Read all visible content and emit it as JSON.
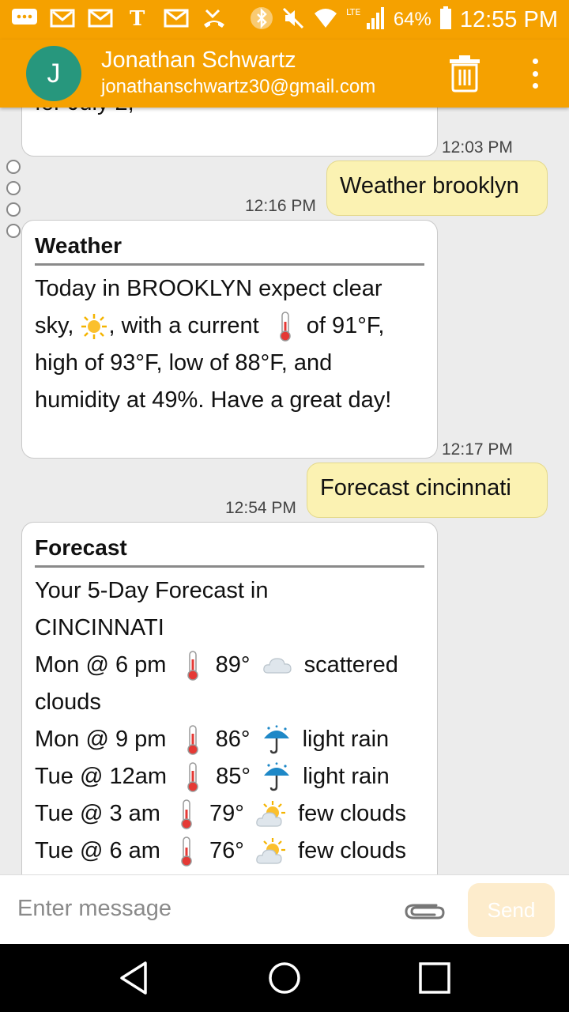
{
  "status_bar": {
    "battery_percent": "64%",
    "time": "12:55 PM",
    "network_label": "LTE"
  },
  "contact": {
    "initial": "J",
    "name": "Jonathan Schwartz",
    "email": "jonathanschwartz30@gmail.com"
  },
  "messages": [
    {
      "time": "12:03 PM",
      "partial_text": "for July 2,"
    },
    {
      "text": "Weather brooklyn",
      "time": "12:16 PM"
    },
    {
      "title": "Weather",
      "time": "12:17 PM",
      "body": {
        "l1": "Today in BROOKLYN expect clear",
        "l2a": "sky,",
        "l2b": ", with a current",
        "l2c": "of 91°F,",
        "l3": "high of 93°F, low of 88°F, and",
        "l4": "humidity at 49%. Have a great day!"
      }
    },
    {
      "text": "Forecast cincinnati",
      "time": "12:54 PM"
    },
    {
      "title": "Forecast",
      "intro1": "Your 5-Day Forecast in",
      "intro2": "CINCINNATI",
      "rows": [
        {
          "when": "Mon @ 6 pm",
          "temp": "89°",
          "condition": "scattered",
          "condition_wrap": "clouds",
          "icon": "cloud-icon"
        },
        {
          "when": "Mon @ 9 pm",
          "temp": "86°",
          "condition": "light rain",
          "icon": "umbrella-rain-icon"
        },
        {
          "when": "Tue @ 12am",
          "temp": "85°",
          "condition": "light rain",
          "icon": "umbrella-rain-icon"
        },
        {
          "when": "Tue @ 3 am",
          "temp": "79°",
          "condition": "few clouds",
          "icon": "sun-behind-cloud-icon"
        },
        {
          "when": "Tue @ 6 am",
          "temp": "76°",
          "condition": "few clouds",
          "icon": "sun-behind-cloud-icon"
        }
      ]
    }
  ],
  "composer": {
    "placeholder": "Enter message",
    "send_label": "Send"
  },
  "colors": {
    "accent": "#f5a100",
    "avatar": "#27977d",
    "outgoing_bubble": "#fbf2b2",
    "incoming_bubble": "#ffffff"
  }
}
